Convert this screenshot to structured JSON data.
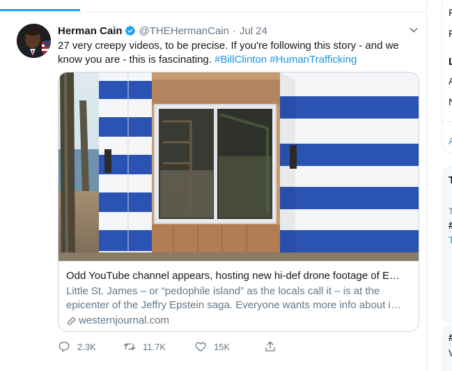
{
  "tweet": {
    "author_name": "Herman Cain",
    "handle": "@THEHermanCain",
    "separator": "·",
    "date": "Jul 24",
    "text_plain": "27 very creepy videos, to be precise. If you're following this story - and we know you are - this is fascinating. ",
    "hashtags": [
      "#BillClinton",
      "#HumanTrafficking"
    ],
    "card": {
      "title": "Odd YouTube channel appears, hosting new hi-def drone footage of E…",
      "description_line1": "Little St. James – or “pedophile island” as the locals call it – is at the",
      "description_line2": "epicenter of the Jeffry Epstein saga.  Everyone wants more info about i…",
      "domain": "westernjournal.com"
    },
    "actions": {
      "replies": "2.3K",
      "retweets": "11.7K",
      "likes": "15K"
    }
  },
  "sidebar_fragments": {
    "letters": [
      "F",
      "F",
      "L",
      "A",
      "N",
      "A",
      "T",
      "T",
      "#",
      "T",
      "#",
      "V"
    ]
  },
  "colors": {
    "accent": "#1da1f2",
    "link": "#1b95e0",
    "verified": "#1da1f2",
    "secondary_text": "#657786",
    "border": "#e6ecf0"
  },
  "icons": [
    "verified-badge-icon",
    "chevron-down-icon",
    "link-icon",
    "reply-icon",
    "retweet-icon",
    "like-icon",
    "share-icon"
  ]
}
